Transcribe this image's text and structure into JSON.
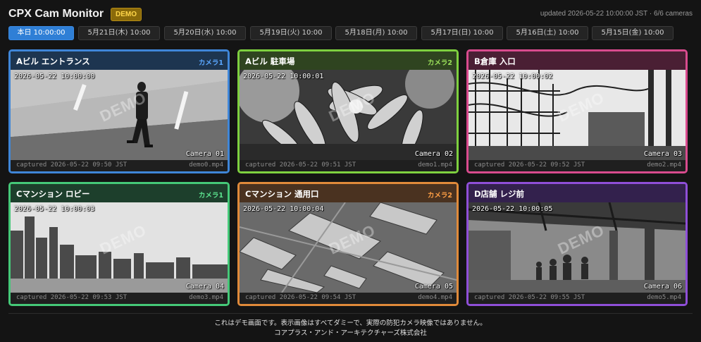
{
  "header": {
    "title": "CPX Cam Monitor",
    "badge": "DEMO",
    "updated": "updated 2026-05-22 10:00:00 JST · 6/6 cameras"
  },
  "tabs": [
    {
      "label": "本日 10:00:00",
      "active": true
    },
    {
      "label": "5月21日(木) 10:00",
      "active": false
    },
    {
      "label": "5月20日(水) 10:00",
      "active": false
    },
    {
      "label": "5月19日(火) 10:00",
      "active": false
    },
    {
      "label": "5月18日(月) 10:00",
      "active": false
    },
    {
      "label": "5月17日(日) 10:00",
      "active": false
    },
    {
      "label": "5月16日(土) 10:00",
      "active": false
    },
    {
      "label": "5月15日(金) 10:00",
      "active": false
    }
  ],
  "cameras": [
    {
      "title": "Aビル エントランス",
      "cam_label": "カメラ1",
      "timestamp": "2026-05-22 10:00:00",
      "overlay_name": "Camera 01",
      "captured": "captured 2026-05-22 09:50 JST",
      "file": "demo0.mp4",
      "watermark": "DEMO",
      "border_color": "#3f86d8",
      "head_bg": "#1d3550",
      "label_color": "#5aa7ff",
      "scene": "entrance"
    },
    {
      "title": "Aビル 駐車場",
      "cam_label": "カメラ2",
      "timestamp": "2026-05-22 10:00:01",
      "overlay_name": "Camera 02",
      "captured": "captured 2026-05-22 09:51 JST",
      "file": "demo1.mp4",
      "watermark": "DEMO",
      "border_color": "#7ed03f",
      "head_bg": "#2f4420",
      "label_color": "#9be05a",
      "scene": "plants"
    },
    {
      "title": "B倉庫 入口",
      "cam_label": "",
      "timestamp": "2026-05-22 10:00:02",
      "overlay_name": "Camera 03",
      "captured": "captured 2026-05-22 09:52 JST",
      "file": "demo2.mp4",
      "watermark": "DEMO",
      "border_color": "#d94b8e",
      "head_bg": "#4a1f34",
      "label_color": "#ff7ab8",
      "scene": "coaster"
    },
    {
      "title": "Cマンション ロビー",
      "cam_label": "カメラ1",
      "timestamp": "2026-05-22 10:00:03",
      "overlay_name": "Camera 04",
      "captured": "captured 2026-05-22 09:53 JST",
      "file": "demo3.mp4",
      "watermark": "DEMO",
      "border_color": "#45c878",
      "head_bg": "#1d3f2c",
      "label_color": "#5be38f",
      "scene": "skyline"
    },
    {
      "title": "Cマンション 通用口",
      "cam_label": "カメラ2",
      "timestamp": "2026-05-22 10:00:04",
      "overlay_name": "Camera 05",
      "captured": "captured 2026-05-22 09:54 JST",
      "file": "demo4.mp4",
      "watermark": "DEMO",
      "border_color": "#e08a3a",
      "head_bg": "#4a3220",
      "label_color": "#ff9f45",
      "scene": "aerial"
    },
    {
      "title": "D店舗 レジ前",
      "cam_label": "",
      "timestamp": "2026-05-22 10:00:05",
      "overlay_name": "Camera 06",
      "captured": "captured 2026-05-22 09:55 JST",
      "file": "demo5.mp4",
      "watermark": "DEMO",
      "border_color": "#8f4fd8",
      "head_bg": "#33214d",
      "label_color": "#b07aff",
      "scene": "store"
    }
  ],
  "footer": {
    "line1": "これはデモ画面です。表示画像はすべてダミーで、実際の防犯カメラ映像ではありません。",
    "line2": "コアプラス・アンド・アーキテクチャーズ株式会社"
  }
}
